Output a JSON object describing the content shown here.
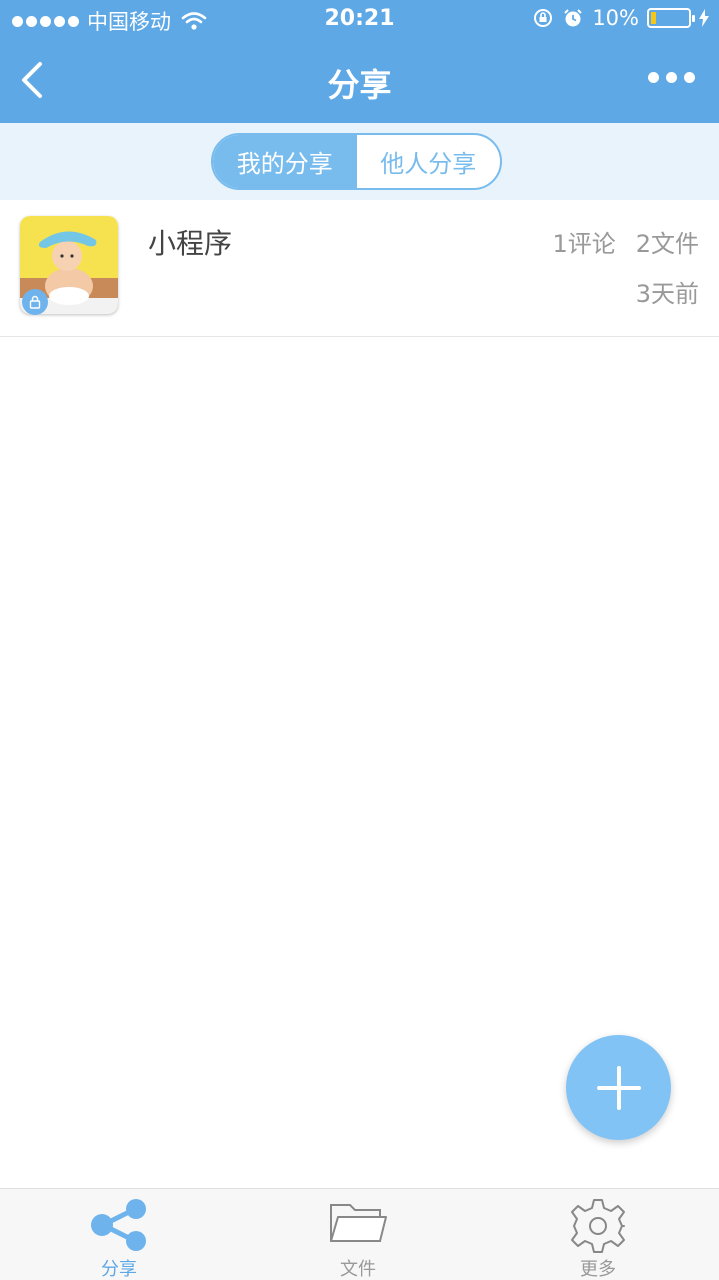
{
  "status_bar": {
    "carrier": "中国移动",
    "time": "20:21",
    "battery": "10%"
  },
  "nav": {
    "title": "分享"
  },
  "segments": {
    "mine": "我的分享",
    "others": "他人分享"
  },
  "list": {
    "items": [
      {
        "title": "小程序",
        "comments": "1评论",
        "files": "2文件",
        "time": "3天前"
      }
    ]
  },
  "tabbar": {
    "share": "分享",
    "files": "文件",
    "more": "更多"
  },
  "colors": {
    "primary": "#5ea8e6",
    "accent": "#78bcee",
    "fab": "#82c3f5"
  }
}
